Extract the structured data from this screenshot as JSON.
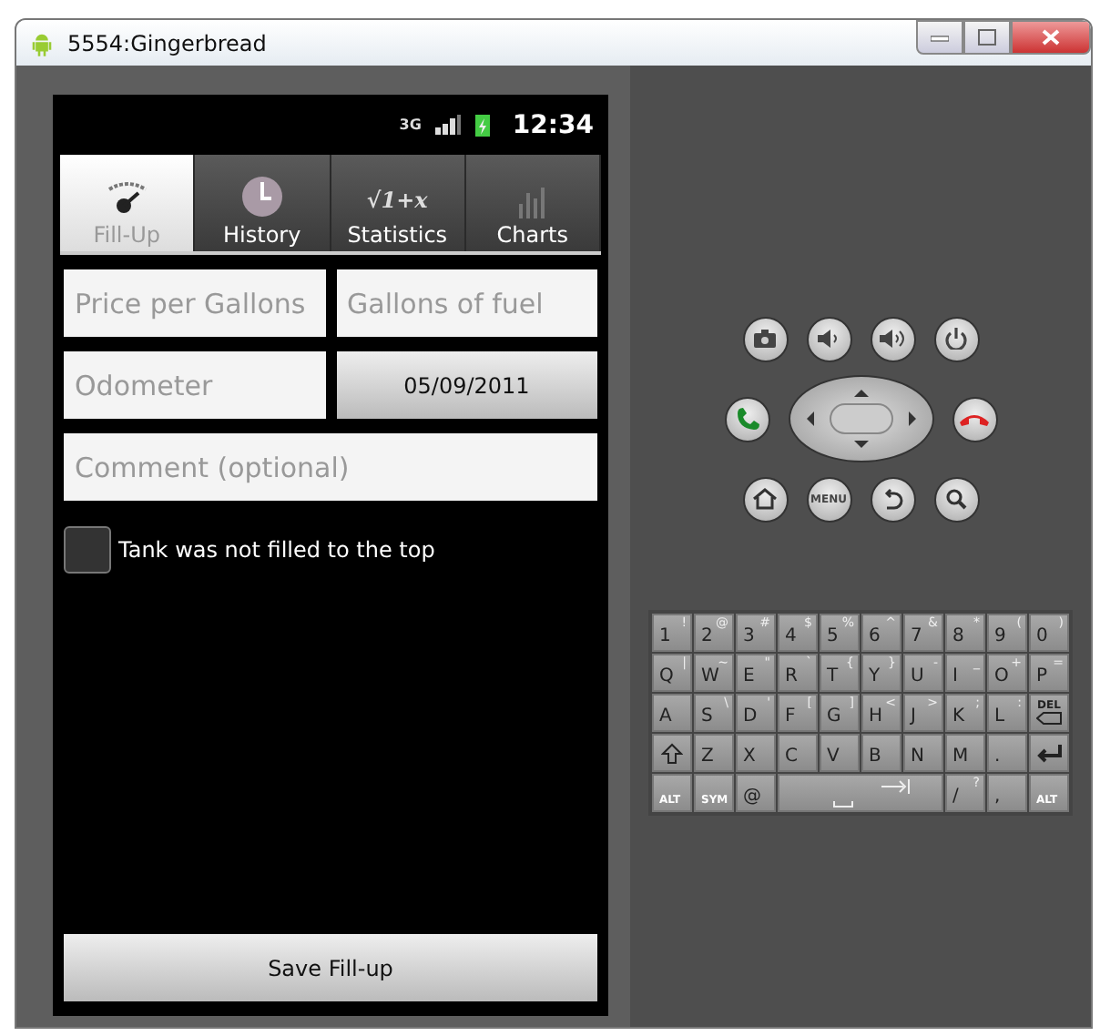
{
  "window": {
    "title": "5554:Gingerbread"
  },
  "status_bar": {
    "network": "3G",
    "time": "12:34"
  },
  "tabs": [
    {
      "label": "Fill-Up",
      "kind": "gauge",
      "selected": true
    },
    {
      "label": "History",
      "kind": "clock",
      "selected": false
    },
    {
      "label": "Statistics",
      "kind": "formula",
      "icon_text": "√1+x",
      "selected": false
    },
    {
      "label": "Charts",
      "kind": "bars",
      "selected": false
    }
  ],
  "form": {
    "rows": [
      [
        {
          "kind": "field",
          "placeholder": "Price per Gallons"
        },
        {
          "kind": "field",
          "placeholder": "Gallons of fuel"
        }
      ],
      [
        {
          "kind": "field",
          "placeholder": "Odometer"
        },
        {
          "kind": "button",
          "label": "05/09/2011"
        }
      ],
      [
        {
          "kind": "field",
          "placeholder": "Comment (optional)"
        }
      ]
    ],
    "checkbox": {
      "label": "Tank was not filled to the top",
      "checked": false
    },
    "save_button": "Save Fill-up"
  },
  "hardware_buttons": [
    [
      {
        "kind": "camera"
      },
      {
        "kind": "volume-down"
      },
      {
        "kind": "volume-up"
      },
      {
        "kind": "power"
      }
    ],
    [
      {
        "kind": "call"
      },
      {
        "kind": "dpad"
      },
      {
        "kind": "end-call"
      }
    ],
    [
      {
        "kind": "home"
      },
      {
        "kind": "menu",
        "label": "MENU"
      },
      {
        "kind": "back"
      },
      {
        "kind": "search"
      }
    ]
  ],
  "keyboard": [
    [
      {
        "label": "1",
        "sub": "!"
      },
      {
        "label": "2",
        "sub": "@"
      },
      {
        "label": "3",
        "sub": "#"
      },
      {
        "label": "4",
        "sub": "$"
      },
      {
        "label": "5",
        "sub": "%"
      },
      {
        "label": "6",
        "sub": "^"
      },
      {
        "label": "7",
        "sub": "&"
      },
      {
        "label": "8",
        "sub": "*"
      },
      {
        "label": "9",
        "sub": "("
      },
      {
        "label": "0",
        "sub": ")"
      }
    ],
    [
      {
        "label": "Q",
        "sub": "|"
      },
      {
        "label": "W",
        "sub": "~"
      },
      {
        "label": "E",
        "sub": "\""
      },
      {
        "label": "R",
        "sub": "`"
      },
      {
        "label": "T",
        "sub": "{"
      },
      {
        "label": "Y",
        "sub": "}"
      },
      {
        "label": "U",
        "sub": "-"
      },
      {
        "label": "I",
        "sub": "_"
      },
      {
        "label": "O",
        "sub": "+"
      },
      {
        "label": "P",
        "sub": "="
      }
    ],
    [
      {
        "label": "A"
      },
      {
        "label": "S",
        "sub": "\\"
      },
      {
        "label": "D",
        "sub": "'"
      },
      {
        "label": "F",
        "sub": "["
      },
      {
        "label": "G",
        "sub": "]"
      },
      {
        "label": "H",
        "sub": "<"
      },
      {
        "label": "J",
        "sub": ">"
      },
      {
        "label": "K",
        "sub": ";"
      },
      {
        "label": "L",
        "sub": ":"
      },
      {
        "kind": "del",
        "label": "DEL"
      }
    ],
    [
      {
        "kind": "shift"
      },
      {
        "label": "Z"
      },
      {
        "label": "X"
      },
      {
        "label": "C"
      },
      {
        "label": "V"
      },
      {
        "label": "B"
      },
      {
        "label": "N"
      },
      {
        "label": "M"
      },
      {
        "label": "."
      },
      {
        "kind": "enter"
      }
    ],
    [
      {
        "label": "ALT",
        "kind": "small"
      },
      {
        "label": "SYM",
        "kind": "small"
      },
      {
        "label": "@"
      },
      {
        "kind": "space"
      },
      {
        "label": "/",
        "sub": "?"
      },
      {
        "label": ","
      },
      {
        "label": "ALT",
        "kind": "small"
      }
    ]
  ]
}
